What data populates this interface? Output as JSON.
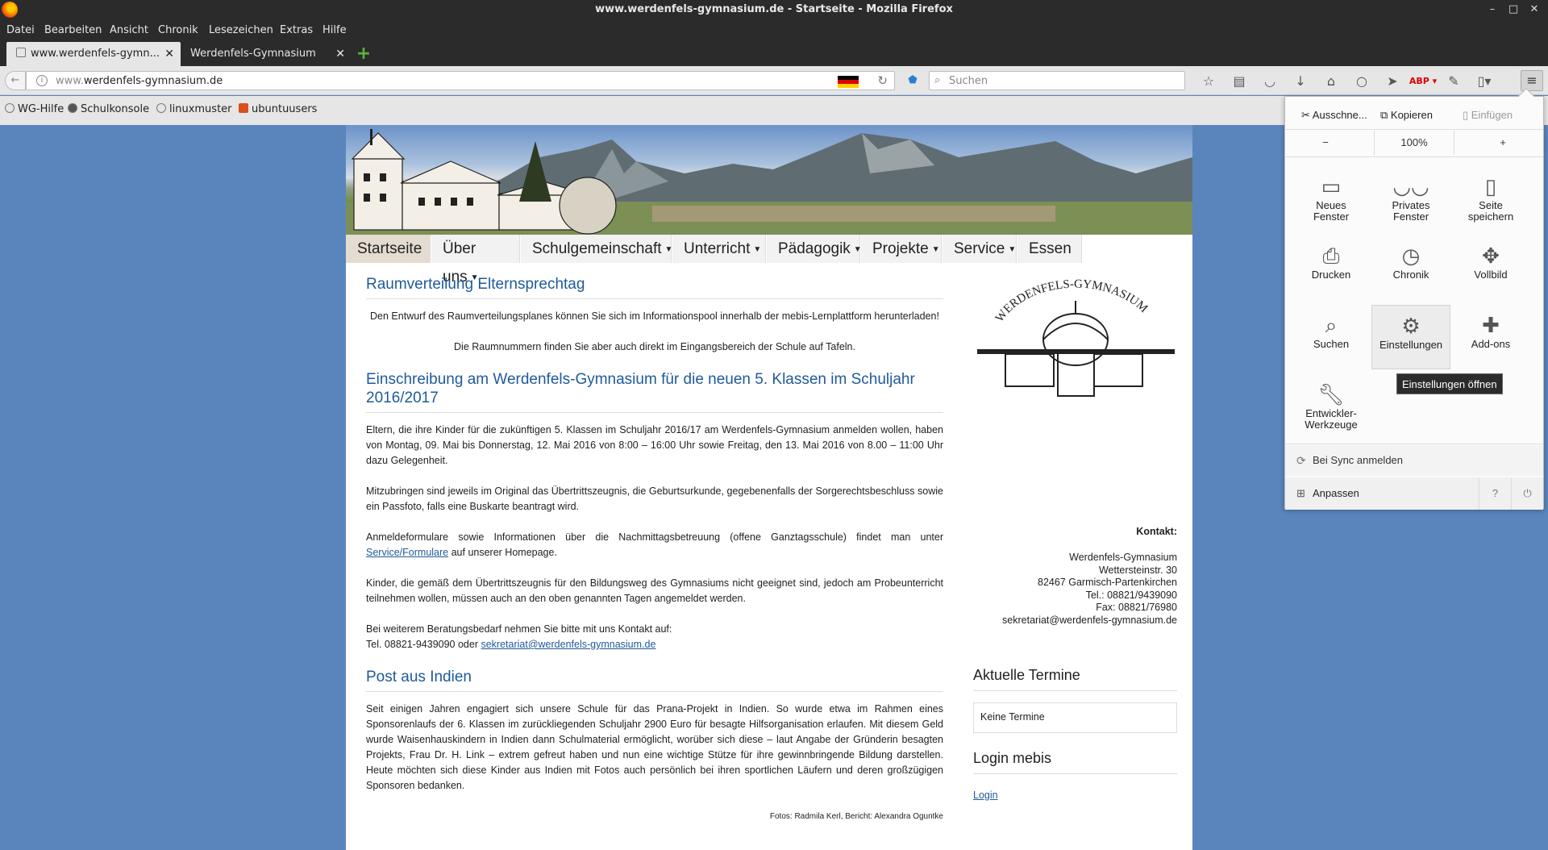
{
  "window": {
    "title": "www.werdenfels-gymnasium.de - Startseite - Mozilla Firefox",
    "controls": [
      "–",
      "□",
      "✕"
    ]
  },
  "menubar": [
    "Datei",
    "Bearbeiten",
    "Ansicht",
    "Chronik",
    "Lesezeichen",
    "Extras",
    "Hilfe"
  ],
  "tabs": [
    {
      "label": "www.werdenfels-gymn...",
      "active": true
    },
    {
      "label": "Werdenfels-Gymnasium",
      "active": false
    }
  ],
  "navbar": {
    "url_prefix": "www.",
    "url_domain": "werdenfels-gymnasium.de",
    "search_placeholder": "Suchen"
  },
  "bookmarks": [
    "WG-Hilfe",
    "Schulkonsole",
    "linuxmuster",
    "ubuntuusers"
  ],
  "site": {
    "nav": [
      "Startseite",
      "Über uns",
      "Schulgemeinschaft",
      "Unterricht",
      "Pädagogik",
      "Projekte",
      "Service",
      "Essen"
    ],
    "articles": [
      {
        "title": "Raumverteilung Elternsprechtag",
        "p1": "Den Entwurf des Raumverteilungsplanes können Sie sich im Informationspool innerhalb der mebis-Lernplattform herunterladen!",
        "p2": "Die Raumnummern finden Sie aber auch direkt im Eingangsbereich der Schule auf Tafeln."
      },
      {
        "title": "Einschreibung am Werdenfels-Gymnasium für die neuen 5. Klassen im Schuljahr 2016/2017",
        "p1": "Eltern, die ihre Kinder für die zukünftigen 5. Klassen im Schuljahr 2016/17 am Werdenfels-Gymnasium anmelden wollen, haben von Montag, 09. Mai bis Donnerstag, 12. Mai 2016 von 8:00 – 16:00 Uhr sowie Freitag, den 13. Mai 2016 von 8.00 – 11:00 Uhr dazu Gelegenheit.",
        "p2": "Mitzubringen sind jeweils im Original das Übertrittszeugnis, die Geburtsurkunde, gegebenenfalls der Sorgerechtsbeschluss sowie ein Passfoto, falls eine Buskarte beantragt wird.",
        "p3_pre": "Anmeldeformulare sowie Informationen über die Nachmittagsbetreuung (offene Ganztagsschule) findet man unter ",
        "p3_link": "Service/Formulare",
        "p3_post": " auf unserer Homepage.",
        "p4": "Kinder, die gemäß dem Übertrittszeugnis für den Bildungsweg des Gymnasiums nicht geeignet sind, jedoch am Probeunterricht teilnehmen wollen, müssen auch an den oben genannten Tagen angemeldet werden.",
        "p5_line1": "Bei weiterem Beratungsbedarf nehmen Sie bitte mit uns Kontakt auf:",
        "p5_pre": "Tel. 08821-9439090 oder ",
        "p5_link": "sekretariat@werdenfels-gymnasium.de"
      },
      {
        "title": "Post aus Indien",
        "p1": "Seit einigen Jahren engagiert sich unsere Schule für das Prana-Projekt in Indien. So wurde etwa im Rahmen eines Sponsorenlaufs der 6. Klassen im zurückliegenden Schuljahr 2900 Euro für besagte Hilfsorganisation erlaufen. Mit diesem Geld wurde Waisenhauskindern in Indien dann Schulmaterial ermöglicht, worüber sich diese – laut Angabe der Gründerin besagten Projekts, Frau Dr. H. Link – extrem gefreut haben und nun eine wichtige Stütze für ihre gewinnbringende Bildung darstellen. Heute möchten sich diese Kinder aus Indien mit Fotos auch persönlich bei ihren sportlichen Läufern und deren großzügigen Sponsoren bedanken.",
        "credit": "Fotos: Radmila Kerl, Bericht: Alexandra Oguntke"
      }
    ],
    "sidebar": {
      "logo_text": "WERDENFELS-GYMNASIUM",
      "kontakt_title": "Kontakt:",
      "kontakt": [
        "Werdenfels-Gymnasium",
        "Wettersteinstr. 30",
        "82467 Garmisch-Partenkirchen",
        "Tel.: 08821/9439090",
        "Fax: 08821/76980",
        "sekretariat@werdenfels-gymnasium.de"
      ],
      "termine_title": "Aktuelle Termine",
      "termine_text": "Keine Termine",
      "login_title": "Login mebis",
      "login_link": "Login"
    }
  },
  "panel": {
    "cut": "Ausschne...",
    "copy": "Kopieren",
    "paste": "Einfügen",
    "zoom_out": "−",
    "zoom_level": "100%",
    "zoom_in": "+",
    "items": [
      {
        "line1": "Neues",
        "line2": "Fenster",
        "icon": "new-window-icon"
      },
      {
        "line1": "Privates",
        "line2": "Fenster",
        "icon": "private-mask-icon"
      },
      {
        "line1": "Seite",
        "line2": "speichern",
        "icon": "save-page-icon"
      },
      {
        "line1": "Drucken",
        "line2": "",
        "icon": "print-icon"
      },
      {
        "line1": "Chronik",
        "line2": "",
        "icon": "history-clock-icon"
      },
      {
        "line1": "Vollbild",
        "line2": "",
        "icon": "fullscreen-icon"
      },
      {
        "line1": "Suchen",
        "line2": "",
        "icon": "search-icon"
      },
      {
        "line1": "Einstellungen",
        "line2": "",
        "icon": "gear-icon"
      },
      {
        "line1": "Add-ons",
        "line2": "",
        "icon": "puzzle-icon"
      },
      {
        "line1": "Entwickler-",
        "line2": "Werkzeuge",
        "icon": "wrench-icon"
      }
    ],
    "sync": "Bei Sync anmelden",
    "customize": "Anpassen",
    "help": "?",
    "quit": "⏻"
  },
  "tooltip": "Einstellungen öffnen"
}
